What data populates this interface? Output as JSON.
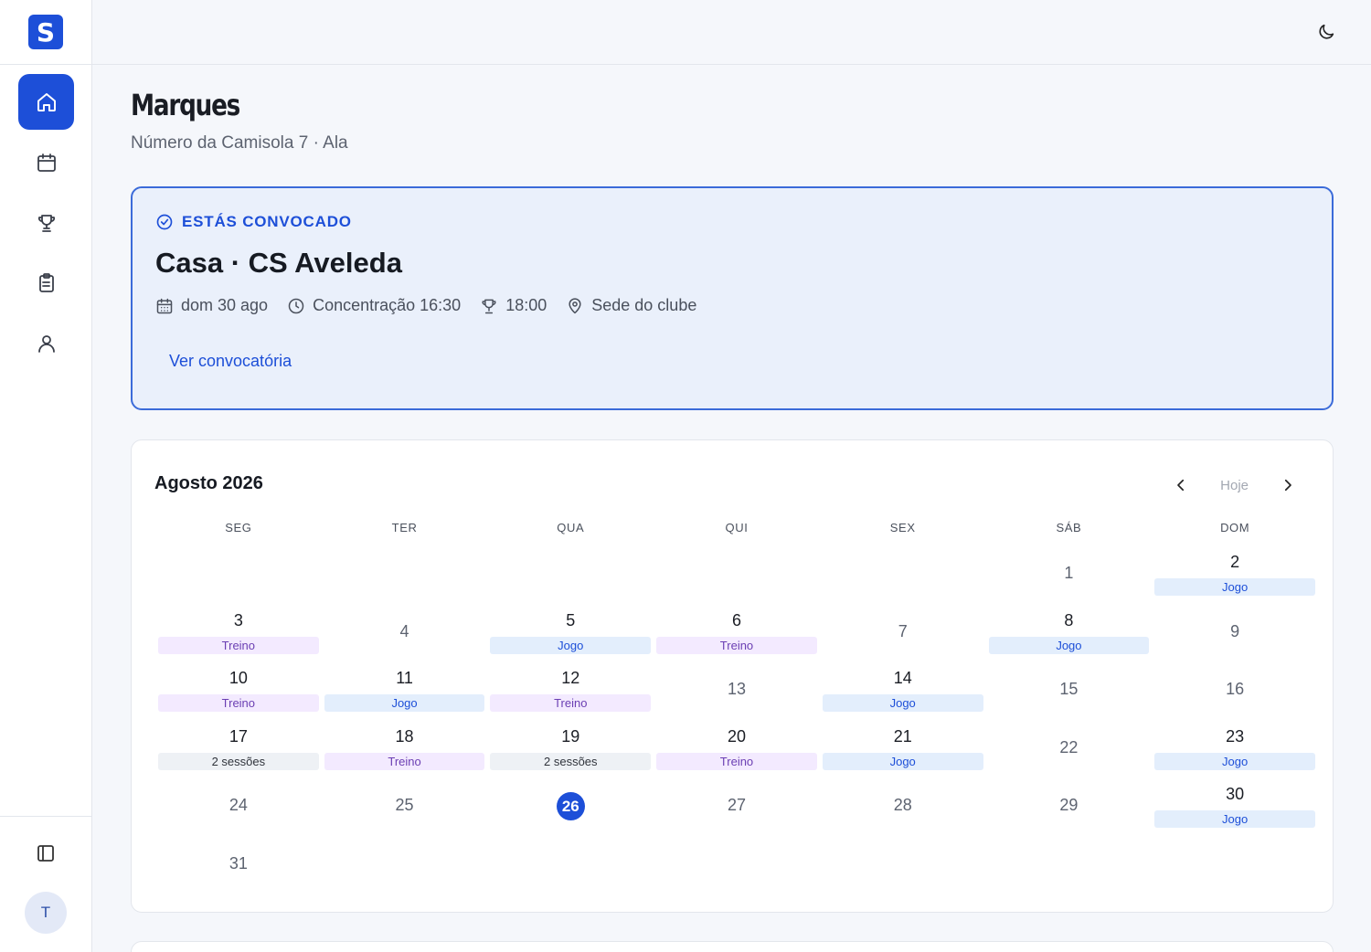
{
  "app": {
    "logo_letter": "S"
  },
  "sidebar": {
    "items": [
      {
        "name": "home",
        "icon": "home-icon",
        "active": true
      },
      {
        "name": "calendar",
        "icon": "calendar-icon",
        "active": false
      },
      {
        "name": "trophy",
        "icon": "trophy-icon",
        "active": false
      },
      {
        "name": "clipboard",
        "icon": "clipboard-list-icon",
        "active": false
      },
      {
        "name": "profile",
        "icon": "user-icon",
        "active": false
      }
    ],
    "collapse_icon": "sidebar-toggle-icon",
    "avatar_initial": "T"
  },
  "topbar": {
    "theme_icon": "moon-icon"
  },
  "player": {
    "name": "Marques",
    "subtitle": "Número da Camisola 7 · Ala"
  },
  "callup": {
    "status": "ESTÁS CONVOCADO",
    "title": "Casa · CS Aveleda",
    "date": "dom 30 ago",
    "gathering": "Concentração 16:30",
    "kickoff": "18:00",
    "location": "Sede do clube",
    "link": "Ver convocatória"
  },
  "calendar": {
    "month": "Agosto 2026",
    "today_label": "Hoje",
    "weekdays": [
      "SEG",
      "TER",
      "QUA",
      "QUI",
      "SEX",
      "SÁB",
      "DOM"
    ],
    "leading_blanks": 5,
    "today": 26,
    "days": [
      {
        "d": "1",
        "e": ""
      },
      {
        "d": "2",
        "e": "Jogo",
        "t": "jogo"
      },
      {
        "d": "3",
        "e": "Treino",
        "t": "treino"
      },
      {
        "d": "4",
        "e": ""
      },
      {
        "d": "5",
        "e": "Jogo",
        "t": "jogo"
      },
      {
        "d": "6",
        "e": "Treino",
        "t": "treino"
      },
      {
        "d": "7",
        "e": ""
      },
      {
        "d": "8",
        "e": "Jogo",
        "t": "jogo"
      },
      {
        "d": "9",
        "e": ""
      },
      {
        "d": "10",
        "e": "Treino",
        "t": "treino"
      },
      {
        "d": "11",
        "e": "Jogo",
        "t": "jogo"
      },
      {
        "d": "12",
        "e": "Treino",
        "t": "treino"
      },
      {
        "d": "13",
        "e": ""
      },
      {
        "d": "14",
        "e": "Jogo",
        "t": "jogo"
      },
      {
        "d": "15",
        "e": ""
      },
      {
        "d": "16",
        "e": ""
      },
      {
        "d": "17",
        "e": "2 sessões",
        "t": "multi"
      },
      {
        "d": "18",
        "e": "Treino",
        "t": "treino"
      },
      {
        "d": "19",
        "e": "2 sessões",
        "t": "multi"
      },
      {
        "d": "20",
        "e": "Treino",
        "t": "treino"
      },
      {
        "d": "21",
        "e": "Jogo",
        "t": "jogo"
      },
      {
        "d": "22",
        "e": ""
      },
      {
        "d": "23",
        "e": "Jogo",
        "t": "jogo"
      },
      {
        "d": "24",
        "e": ""
      },
      {
        "d": "25",
        "e": ""
      },
      {
        "d": "26",
        "e": ""
      },
      {
        "d": "27",
        "e": ""
      },
      {
        "d": "28",
        "e": ""
      },
      {
        "d": "29",
        "e": ""
      },
      {
        "d": "30",
        "e": "Jogo",
        "t": "jogo"
      },
      {
        "d": "31",
        "e": ""
      }
    ]
  }
}
